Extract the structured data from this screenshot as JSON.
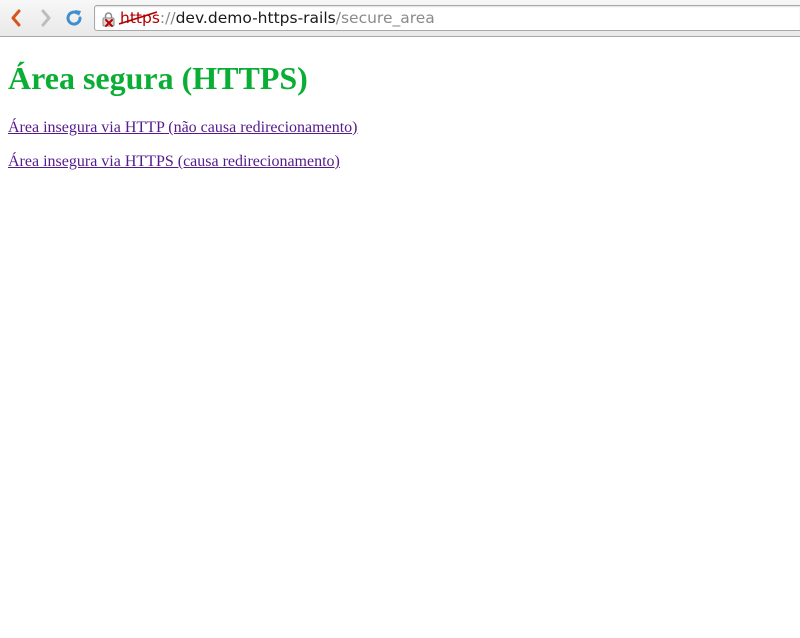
{
  "browser": {
    "back_icon": "chevron-left-icon",
    "forward_icon": "chevron-right-icon",
    "reload_icon": "reload-icon",
    "security_icon": "insecure-lock-icon",
    "url": {
      "scheme": "https",
      "separator": "://",
      "host": "dev.demo-https-rails",
      "path": "/secure_area"
    }
  },
  "page": {
    "heading": "Área segura (HTTPS)",
    "heading_color": "#0bae35",
    "links": [
      "Área insegura via HTTP (não causa redirecionamento)",
      "Área insegura via HTTPS (causa redirecionamento)"
    ],
    "link_color": "#551a8b"
  }
}
